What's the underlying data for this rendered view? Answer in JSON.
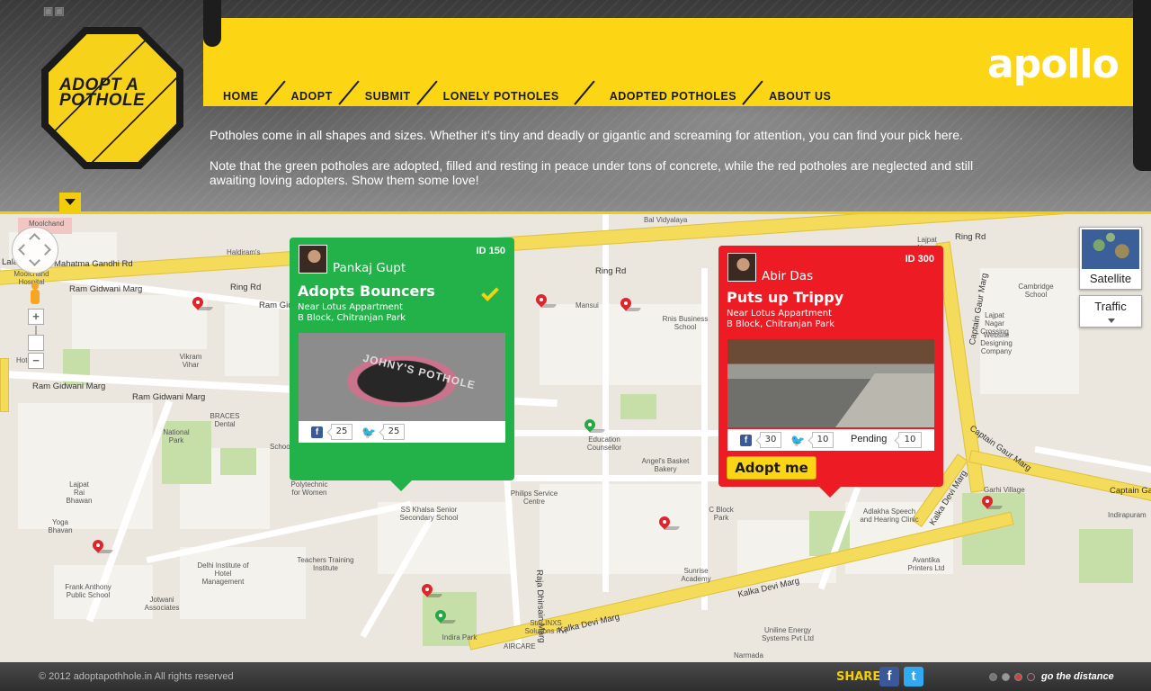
{
  "header": {
    "logo_text": "ADOPT A POTHOLE",
    "brand": "apollo",
    "nav": [
      {
        "label": "HOME"
      },
      {
        "label": "ADOPT"
      },
      {
        "label": "SUBMIT"
      },
      {
        "label": "LONELY POTHOLES"
      },
      {
        "label": "ADOPTED POTHOLES"
      },
      {
        "label": "ABOUT US"
      }
    ],
    "intro_line1": "Potholes come in all shapes and sizes. Whether it’s tiny and deadly or gigantic and screaming for attention, you can find your pick here.",
    "intro_line2": "Note that the green potholes are adopted, filled and resting in peace under tons of concrete, while the red potholes are neglected and still awaiting loving adopters. Show them some love!"
  },
  "map": {
    "controls": {
      "zoom_in": "+",
      "zoom_out": "−",
      "satellite_label": "Satellite",
      "traffic_label": "Traffic"
    },
    "roads": [
      "Mahatma Gandhi Rd",
      "Ram Gidwani Marg",
      "Ring Rd",
      "Ring Rd",
      "Ram Gidwani Marg",
      "Ram Gidwani Marg",
      "Ram Gidwani Marg",
      "Ring Rd",
      "Captain Gaur Marg",
      "Captain Gaur Marg",
      "Captain Gaur Marg",
      "Kalka Devi Marg",
      "Kalka Devi Marg",
      "Kalka Devi Marg",
      "Raja Dhirsain Marg",
      "Lala",
      "Captain Ga"
    ],
    "places": [
      "Moolchand",
      "Haldiram's",
      "Vikram Vihar",
      "BRACES Dental",
      "National Park",
      "Lajpat Rai Bhawan",
      "Yoga Bhavan",
      "Frank Anthony Public School",
      "Delhi Institute of Hotel Management",
      "Jotwani Associates",
      "Polytechnic for Women",
      "SS Khalsa Senior Secondary School",
      "Teachers Training Institute",
      "Philips Service Centre",
      "Education Counsellor",
      "Angel's Basket Bakery",
      "Rnis Business School",
      "Mansui",
      "Indira Park",
      "Star INXS Solutions Pvt",
      "AIRCARE",
      "Sunrise Academy",
      "C Block Park",
      "Bal Vidyalaya",
      "Lajpat Nagar Crossing",
      "Cambridge School",
      "Website Designing Company",
      "Garhi Village",
      "Adlakha Speech and Hearing Clinic",
      "Avantika Printers Ltd",
      "Uniline Energy Systems Pvt Ltd",
      "Narmada",
      "Lajpat Nagar",
      "Moolchand Hospital",
      "Indirapuram",
      "School",
      "Hotel"
    ],
    "pins": [
      {
        "status": "red"
      },
      {
        "status": "red"
      },
      {
        "status": "red"
      },
      {
        "status": "red"
      },
      {
        "status": "red"
      },
      {
        "status": "red"
      },
      {
        "status": "red"
      },
      {
        "status": "green"
      },
      {
        "status": "green"
      }
    ],
    "popups": [
      {
        "id_label": "ID 150",
        "status": "adopted",
        "user": "Pankaj Gupt",
        "title": "Adopts Bouncers",
        "address_line1": "Near Lotus Appartment",
        "address_line2": "B Block, Chitranjan Park",
        "photo_caption": "JOHNY'S POTHOLE",
        "facebook_count": "25",
        "twitter_count": "25"
      },
      {
        "id_label": "ID 300",
        "status": "pending",
        "user": "Abir Das",
        "title": "Puts up Trippy",
        "address_line1": "Near Lotus Appartment",
        "address_line2": "B Block, Chitranjan Park",
        "facebook_count": "30",
        "twitter_count": "10",
        "pending_label": "Pending",
        "pending_count": "10",
        "adopt_button": "Adopt me"
      }
    ]
  },
  "footer": {
    "copyright": "© 2012 adoptapothhole.in All rights reserved",
    "share_label": "SHARE",
    "tagline": "go the distance"
  },
  "colors": {
    "accent_yellow": "#fcd615",
    "adopted_green": "#23b14a",
    "pending_red": "#ed1c24"
  }
}
